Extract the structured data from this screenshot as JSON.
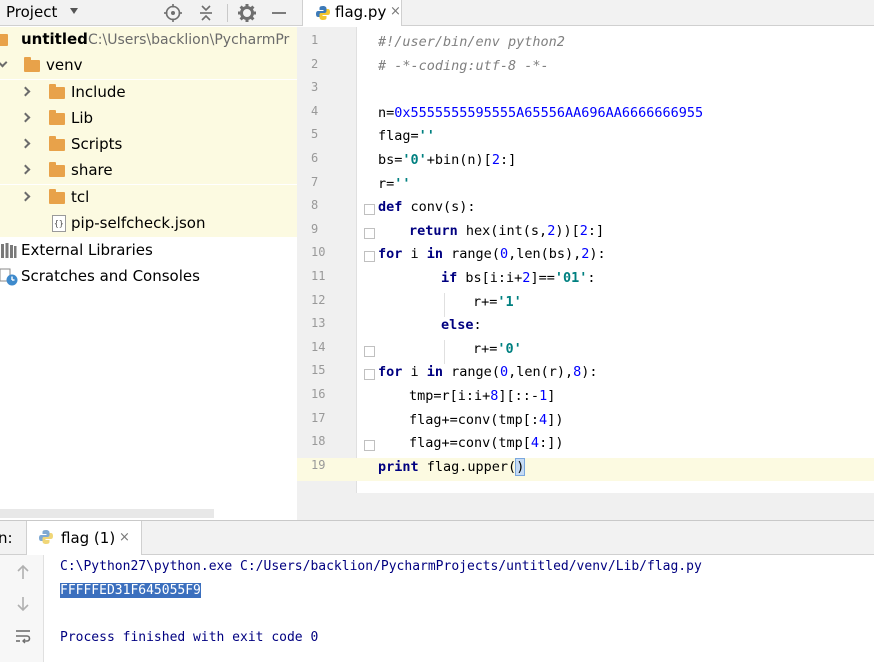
{
  "project_panel": {
    "title": "Project",
    "icons": [
      "target-icon",
      "collapse-icon",
      "gear-icon",
      "minimize-icon"
    ],
    "root": {
      "name": "untitled",
      "path": "C:\\Users\\backlion\\PycharmPr"
    },
    "venv": "venv",
    "folders": [
      "Include",
      "Lib",
      "Scripts",
      "share",
      "tcl"
    ],
    "file": "pip-selfcheck.json",
    "external_libraries": "External Libraries",
    "scratches": "Scratches and Consoles"
  },
  "editor": {
    "tab_label": "flag.py",
    "tab_close": "×",
    "line_numbers": [
      "1",
      "2",
      "3",
      "4",
      "5",
      "6",
      "7",
      "8",
      "9",
      "10",
      "11",
      "12",
      "13",
      "14",
      "15",
      "16",
      "17",
      "18",
      "19"
    ],
    "code": {
      "l1": "#!/user/bin/env python2",
      "l2": "# -*-coding:utf-8 -*-",
      "l4_a": "n=",
      "l4_b": "0x5555555595555A65556AA696AA6666666955",
      "l5_a": "flag=",
      "l5_b": "''",
      "l6_a": "bs=",
      "l6_b": "'0'",
      "l6_c": "+bin(n)[",
      "l6_d": "2",
      "l6_e": ":]",
      "l7_a": "r=",
      "l7_b": "''",
      "l8_a": "def",
      "l8_b": " conv(s):",
      "l9_a": "return",
      "l9_b": " hex(int(s,",
      "l9_c": "2",
      "l9_d": "))[",
      "l9_e": "2",
      "l9_f": ":]",
      "l10_a": "for",
      "l10_b": " i ",
      "l10_c": "in",
      "l10_d": " range(",
      "l10_e": "0",
      "l10_f": ",len(bs),",
      "l10_g": "2",
      "l10_h": "):",
      "l11_a": "if",
      "l11_b": " bs[i:i+",
      "l11_c": "2",
      "l11_d": "]==",
      "l11_e": "'01'",
      "l11_f": ":",
      "l12_a": "r+=",
      "l12_b": "'1'",
      "l13_a": "else",
      "l13_b": ":",
      "l14_a": "r+=",
      "l14_b": "'0'",
      "l15_a": "for",
      "l15_b": " i ",
      "l15_c": "in",
      "l15_d": " range(",
      "l15_e": "0",
      "l15_f": ",len(r),",
      "l15_g": "8",
      "l15_h": "):",
      "l16_a": "tmp=r[i:i+",
      "l16_b": "8",
      "l16_c": "][::-",
      "l16_d": "1",
      "l16_e": "]",
      "l17_a": "flag+=conv(tmp[:",
      "l17_b": "4",
      "l17_c": "])",
      "l18_a": "flag+=conv(tmp[",
      "l18_b": "4",
      "l18_c": ":])",
      "l19_a": "print",
      "l19_b": " flag.upper(",
      "l19_c": ")"
    }
  },
  "run_panel": {
    "prefix": "n:",
    "tab_label": "flag (1)",
    "tab_close": "×",
    "toolbar": [
      "up-arrow-icon",
      "down-arrow-icon",
      "soft-wrap-icon"
    ],
    "console": {
      "command": "C:\\Python27\\python.exe C:/Users/backlion/PycharmProjects/untitled/venv/Lib/flag.py",
      "output": "FFFFFED31F645055F9",
      "exit": "Process finished with exit code 0"
    }
  },
  "colors": {
    "keyword": "#000080",
    "number": "#0000ff",
    "string": "#008080",
    "comment": "#808080",
    "current_line": "#fcfae1",
    "selection": "#3b6fbe"
  }
}
